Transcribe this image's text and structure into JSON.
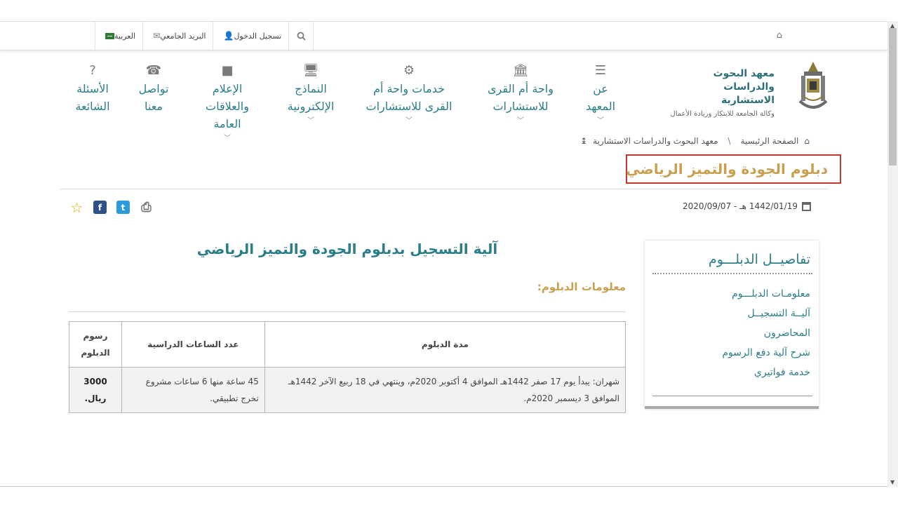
{
  "topbar": {
    "login": "تسجيل الدخول",
    "mail": "البريد الجامعي",
    "language": "العربية"
  },
  "logo": {
    "line1": "معهد البحوث والدراسات الاستشارية",
    "line2": "وكالة الجامعة للابتكار وريادة الأعمال"
  },
  "nav": {
    "about": "عن المعهد",
    "oasis": "واحة أم القرى للاستشارات",
    "services": "خدمات واحة أم القرى للاستشارات",
    "forms": "النماذج الإلكترونية",
    "media": "الإعلام والعلاقات العامة",
    "contact": "تواصل معنا",
    "faq": "الأسئلة الشائعة"
  },
  "breadcrumb": {
    "home": "الصفحة الرئيسية",
    "separator": "\\",
    "current": "معهد البحوث والدراسات الاستشارية",
    "arrow": "↨"
  },
  "page": {
    "title": "دبلوم الجودة والتميز الرياضي",
    "date": "1442/01/19 هـ - 2020/09/07",
    "heading": "آلية التسجيل بدبلوم الجودة والتميز الرياضي",
    "info_label": "معلومات الدبلوم:"
  },
  "table": {
    "headers": {
      "duration": "مدة الدبلوم",
      "hours": "عدد الساعات الدراسية",
      "fees": "رسوم الدبلوم"
    },
    "row": {
      "duration": "شهران: يبدأ يوم 17 صفر 1442هـ الموافق 4 أكتوبر 2020م، وينتهي في 18 ربيع الآخر 1442هـ الموافق 3 ديسمبر 2020م.",
      "hours": "45 ساعة منها 6 ساعات مشروع تخرج تطبيقي.",
      "fees": "3000 ريال."
    }
  },
  "sidebar": {
    "title": "تفاصيــل الدبلـــوم",
    "items": [
      "معلومـات الدبلـــوم",
      "آليــة التسجيــل",
      "المحاضرون",
      "شرح آلية دفع الرسوم",
      "خدمة فواتيري"
    ]
  },
  "colors": {
    "accent": "#2a7e8a",
    "gold": "#c8a050",
    "highlight_border": "#c0392b"
  }
}
